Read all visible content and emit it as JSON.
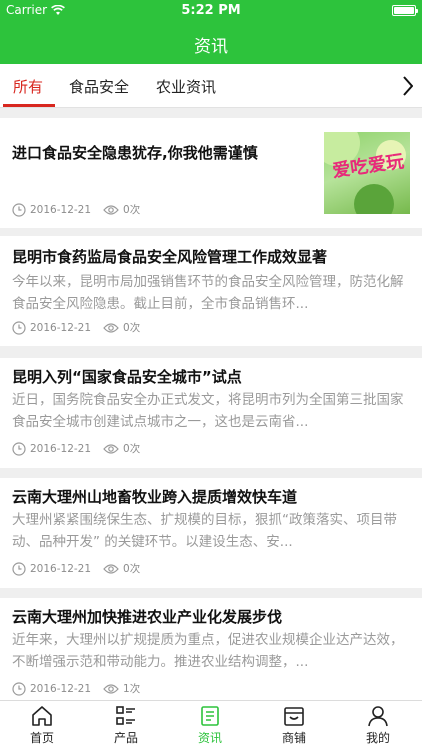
{
  "status": {
    "carrier": "Carrier",
    "time": "5:22 PM"
  },
  "nav": {
    "title": "资讯"
  },
  "tabs": [
    {
      "label": "所有",
      "active": true
    },
    {
      "label": "食品安全",
      "active": false
    },
    {
      "label": "农业资讯",
      "active": false
    }
  ],
  "articles": [
    {
      "title": "进口食品安全隐患犹存,你我他需谨慎",
      "summary": "",
      "date": "2016-12-21",
      "views": "0次",
      "thumbnail_text": "爱吃爱玩"
    },
    {
      "title": "昆明市食药监局食品安全风险管理工作成效显著",
      "summary": "今年以来，昆明市局加强销售环节的食品安全风险管理，防范化解食品安全风险隐患。截止目前，全市食品销售环...",
      "date": "2016-12-21",
      "views": "0次"
    },
    {
      "title": "昆明入列“国家食品安全城市”试点",
      "summary": "近日，国务院食品安全办正式发文，将昆明市列为全国第三批国家食品安全城市创建试点城市之一，这也是云南省...",
      "date": "2016-12-21",
      "views": "0次"
    },
    {
      "title": "云南大理州山地畜牧业跨入提质增效快车道",
      "summary": "大理州紧紧围绕保生态、扩规模的目标，狠抓“政策落实、项目带动、品种开发” 的关键环节。以建设生态、安...",
      "date": "2016-12-21",
      "views": "0次"
    },
    {
      "title": "云南大理州加快推进农业产业化发展步伐",
      "summary": "近年来，大理州以扩规提质为重点，促进农业规模企业达产达效，不断增强示范和带动能力。推进农业结构调整，...",
      "date": "2016-12-21",
      "views": "1次"
    }
  ],
  "bottom_nav": [
    {
      "label": "首页",
      "icon": "home-icon"
    },
    {
      "label": "产品",
      "icon": "product-list-icon"
    },
    {
      "label": "资讯",
      "icon": "news-icon",
      "active": true
    },
    {
      "label": "商铺",
      "icon": "shop-icon"
    },
    {
      "label": "我的",
      "icon": "user-icon"
    }
  ],
  "colors": {
    "brand_green": "#2dc33c",
    "tab_active_red": "#d8271f"
  }
}
